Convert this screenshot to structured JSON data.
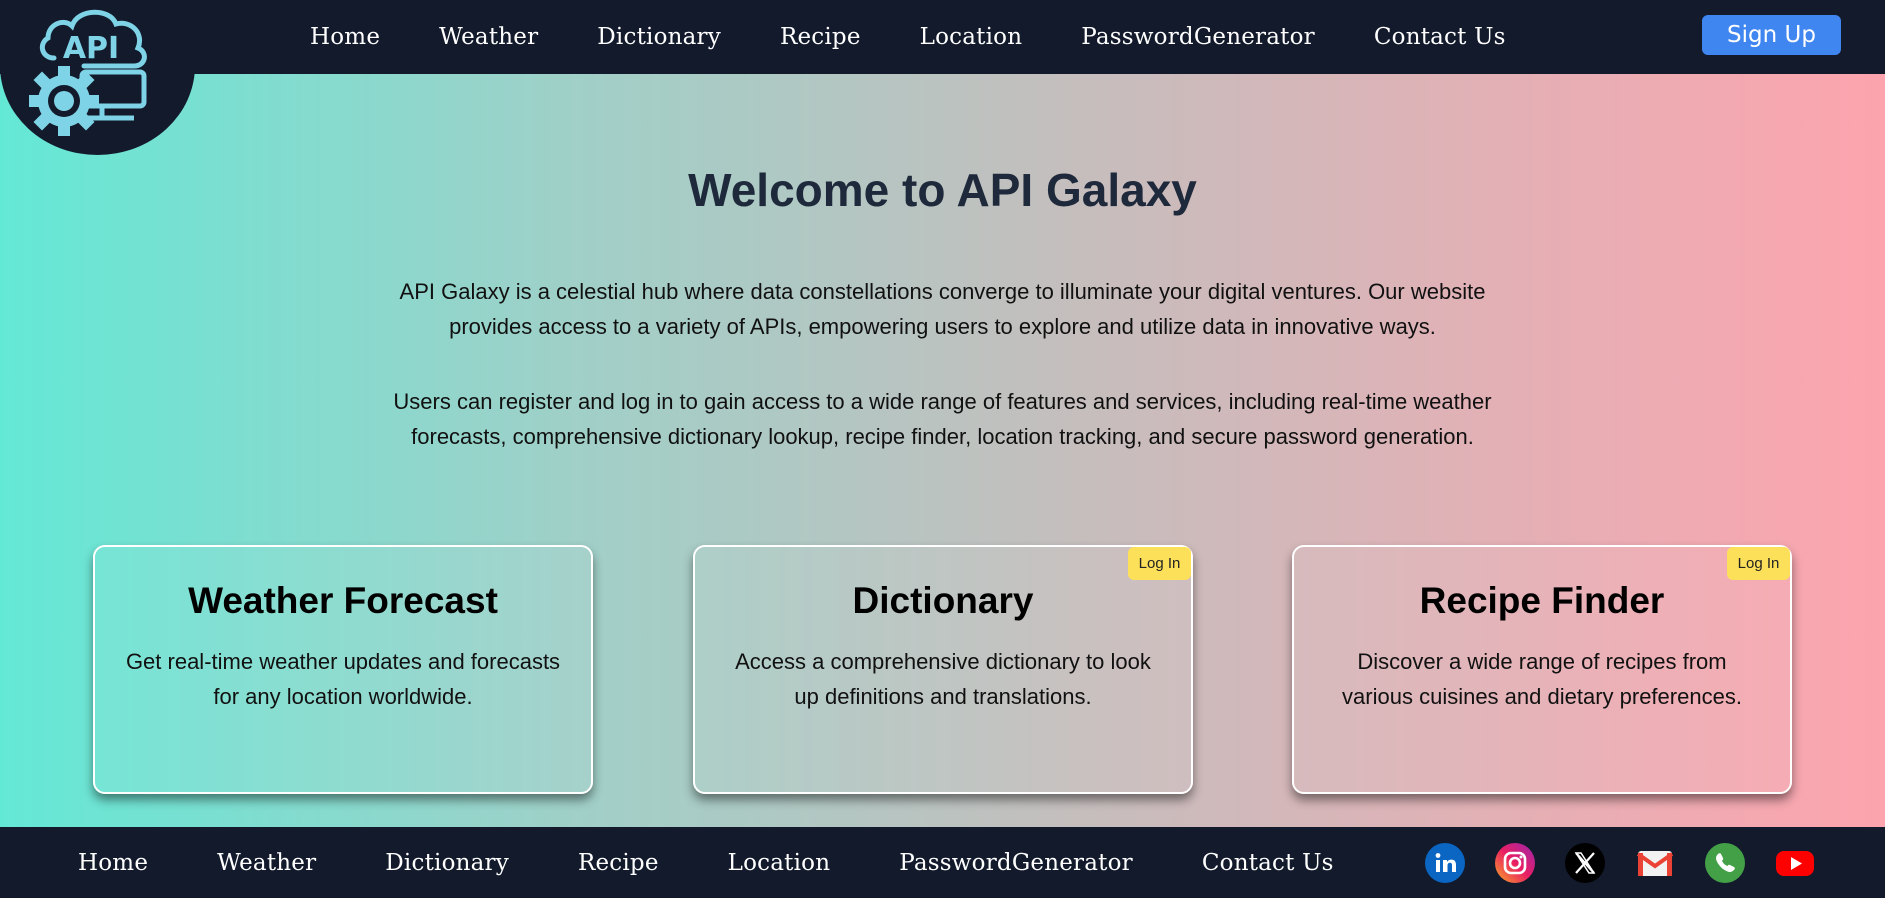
{
  "header": {
    "logo_text": "API",
    "nav": [
      "Home",
      "Weather",
      "Dictionary",
      "Recipe",
      "Location",
      "PasswordGenerator",
      "Contact Us"
    ],
    "signup_label": "Sign Up"
  },
  "hero": {
    "title": "Welcome to API Galaxy",
    "paragraph1": "API Galaxy is a celestial hub where data constellations converge to illuminate your digital ventures. Our website provides access to a variety of APIs, empowering users to explore and utilize data in innovative ways.",
    "paragraph2": "Users can register and log in to gain access to a wide range of features and services, including real-time weather forecasts, comprehensive dictionary lookup, recipe finder, location tracking, and secure password generation."
  },
  "cards": [
    {
      "title": "Weather Forecast",
      "desc": "Get real-time weather updates and forecasts for any location worldwide.",
      "login": ""
    },
    {
      "title": "Dictionary",
      "desc": "Access a comprehensive dictionary to look up definitions and translations.",
      "login": "Log In"
    },
    {
      "title": "Recipe Finder",
      "desc": "Discover a wide range of recipes from various cuisines and dietary preferences.",
      "login": "Log In"
    }
  ],
  "footer": {
    "nav": [
      "Home",
      "Weather",
      "Dictionary",
      "Recipe",
      "Location",
      "PasswordGenerator",
      "Contact Us"
    ],
    "social_icons": [
      "linkedin-icon",
      "instagram-icon",
      "x-icon",
      "gmail-icon",
      "phone-icon",
      "youtube-icon"
    ]
  },
  "colors": {
    "navbar": "#121a2c",
    "signup": "#3f86f0",
    "login_badge": "#fde05a",
    "gradient_left": "#64e8d6",
    "gradient_right": "#fda4ae"
  }
}
